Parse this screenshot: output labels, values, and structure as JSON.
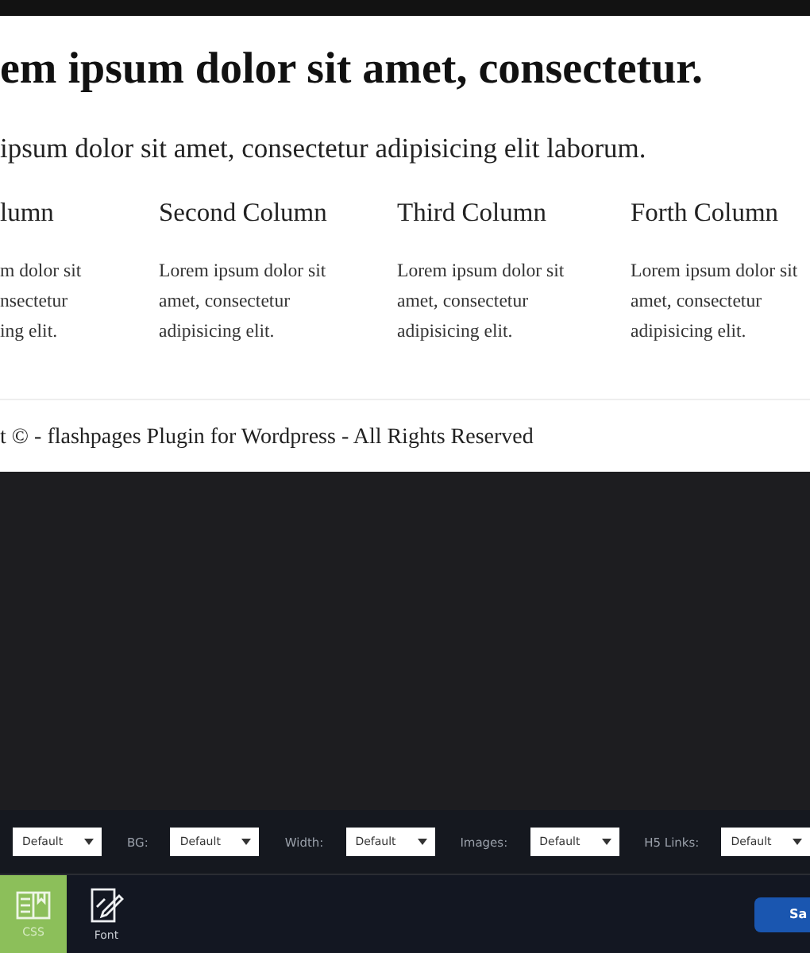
{
  "page": {
    "heading": "em ipsum dolor sit amet, consectetur.",
    "intro": "ipsum dolor sit amet, consectetur adipisicing elit laborum.",
    "columns": [
      {
        "title": "lumn",
        "text": "m dolor sit\nnsectetur\ning elit."
      },
      {
        "title": "Second Column",
        "text": "Lorem ipsum dolor sit\namet, consectetur\nadipisicing elit."
      },
      {
        "title": "Third Column",
        "text": "Lorem ipsum dolor sit\namet, consectetur\nadipisicing elit."
      },
      {
        "title": "Forth Column",
        "text": "Lorem ipsum dolor sit\namet, consectetur\nadipisicing elit."
      }
    ],
    "footer": "t © - flashpages Plugin for Wordpress - All Rights Reserved"
  },
  "toolbar": [
    {
      "value": "Default"
    },
    {
      "label": "BG:",
      "value": "Default"
    },
    {
      "label": "Width:",
      "value": "Default"
    },
    {
      "label": "Images:",
      "value": "Default"
    },
    {
      "label": "H5 Links:",
      "value": "Default"
    }
  ],
  "tabs": [
    {
      "kind": "css",
      "label": "CSS",
      "selected": true
    },
    {
      "kind": "font",
      "label": "Font",
      "selected": false
    }
  ],
  "save_button": "Sa"
}
